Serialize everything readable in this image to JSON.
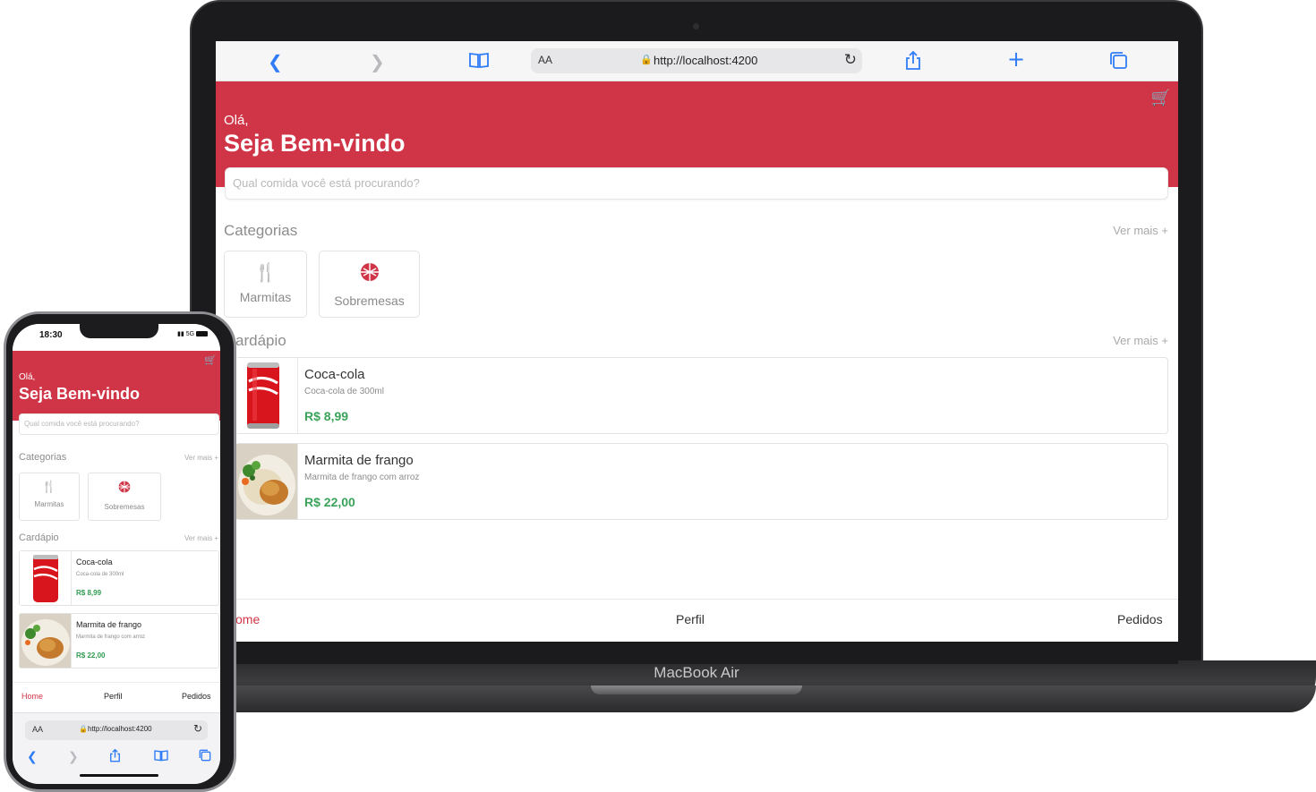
{
  "laptop": {
    "brand": "MacBook Air",
    "browser": {
      "aa": "AA",
      "url": "http://localhost:4200"
    },
    "app": {
      "greeting": "Olá,",
      "welcome": "Seja Bem-vindo",
      "search_placeholder": "Qual comida você está procurando?",
      "categories_title": "Categorias",
      "categories_more": "Ver mais +",
      "categories": [
        {
          "icon": "cutlery-icon",
          "label": "Marmitas"
        },
        {
          "icon": "dessert-icon",
          "label": "Sobremesas"
        }
      ],
      "menu_title": "ardápio",
      "menu_more": "Ver mais +",
      "items": [
        {
          "name": "Coca-cola",
          "description": "Coca-cola de 300ml",
          "price": "R$ 8,99"
        },
        {
          "name": "Marmita de frango",
          "description": "Marmita de frango com arroz",
          "price": "R$ 22,00"
        }
      ],
      "nav": {
        "home": "ome",
        "profile": "Perfil",
        "orders": "Pedidos"
      }
    }
  },
  "phone": {
    "status": {
      "time": "18:30",
      "signal": "5G"
    },
    "app": {
      "greeting": "Olá,",
      "welcome": "Seja Bem-vindo",
      "search_placeholder": "Qual comida você está procurando?",
      "categories_title": "Categorias",
      "categories_more": "Ver mais +",
      "categories": [
        {
          "icon": "cutlery-icon",
          "label": "Marmitas"
        },
        {
          "icon": "dessert-icon",
          "label": "Sobremesas"
        }
      ],
      "menu_title": "Cardápio",
      "menu_more": "Ver mais +",
      "items": [
        {
          "name": "Coca-cola",
          "description": "Coca-cola de 300ml",
          "price": "R$ 8,99"
        },
        {
          "name": "Marmita de frango",
          "description": "Marmita de frango com arroz",
          "price": "R$ 22,00"
        }
      ],
      "nav": {
        "home": "Home",
        "profile": "Perfil",
        "orders": "Pedidos"
      }
    },
    "browser": {
      "aa": "AA",
      "url": "http://localhost:4200"
    }
  },
  "colors": {
    "brand": "#d03447",
    "price": "#3aa35a",
    "browser_accent": "#2f7cf6"
  }
}
